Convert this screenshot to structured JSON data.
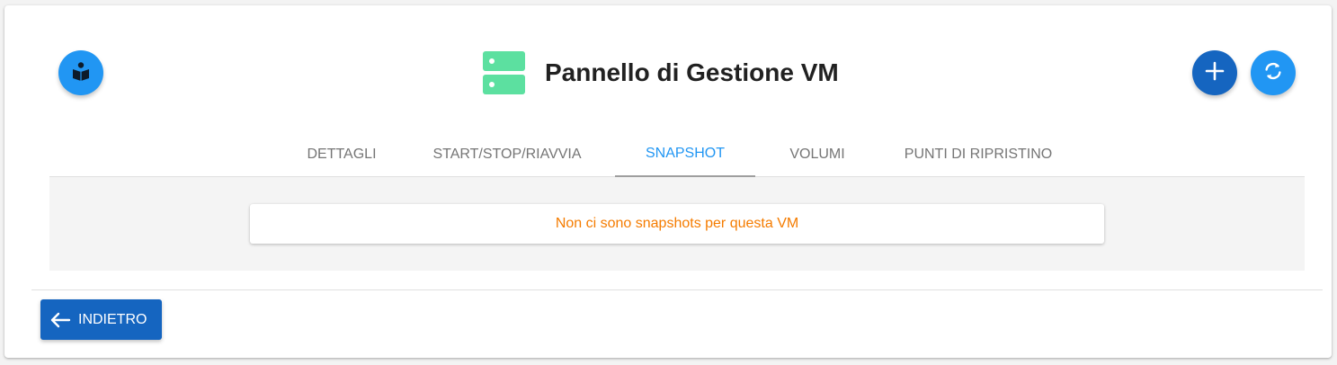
{
  "header": {
    "title": "Pannello di Gestione VM",
    "guide_icon": "book-reader-icon",
    "title_icon": "server-icon",
    "add_icon": "plus-icon",
    "refresh_icon": "refresh-icon"
  },
  "tabs": [
    {
      "label": "DETTAGLI",
      "active": false
    },
    {
      "label": "START/STOP/RIAVVIA",
      "active": false
    },
    {
      "label": "SNAPSHOT",
      "active": true
    },
    {
      "label": "VOLUMI",
      "active": false
    },
    {
      "label": "PUNTI DI RIPRISTINO",
      "active": false
    }
  ],
  "snapshot_panel": {
    "empty_message": "Non ci sono snapshots per questa VM"
  },
  "footer": {
    "back_label": "INDIETRO",
    "back_icon": "arrow-left-icon"
  },
  "colors": {
    "primary": "#2196f3",
    "primary_dark": "#1565c0",
    "server_icon": "#5ce0a0",
    "warning_text": "#f57c00"
  }
}
